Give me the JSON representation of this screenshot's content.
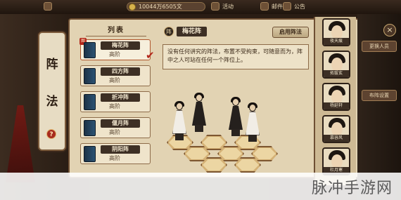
{
  "hud": {
    "resource_value": "10044万6505文",
    "item_labels": [
      "活动",
      "邮件",
      "公告"
    ]
  },
  "left_panel": {
    "title_chars": [
      "阵",
      "法"
    ],
    "help_glyph": "?"
  },
  "list": {
    "header": "列表",
    "items": [
      {
        "name": "梅花阵",
        "tier": "高阶",
        "selected": true
      },
      {
        "name": "四方阵",
        "tier": "高阶",
        "selected": false
      },
      {
        "name": "折冲阵",
        "tier": "高阶",
        "selected": false
      },
      {
        "name": "偃月阵",
        "tier": "高阶",
        "selected": false
      },
      {
        "name": "阴阳阵",
        "tier": "高阶",
        "selected": false
      }
    ],
    "selected_tag": "图"
  },
  "detail": {
    "emblem": "阵",
    "title": "梅花阵",
    "enable_button": "启用阵法",
    "description": "没有任何讲究的阵法，布置不受拘束，可随意而为，阵中之人可站在任何一个阵位上。"
  },
  "portraits": [
    {
      "name": "夜天痕"
    },
    {
      "name": "拓拔玄"
    },
    {
      "name": "杨延轩"
    },
    {
      "name": "慕容风"
    },
    {
      "name": "杜月寒"
    }
  ],
  "right_panel": {
    "buttons": [
      "更换人员",
      "布阵设置"
    ],
    "close_glyph": "×"
  },
  "watermark": "脉冲手游网"
}
